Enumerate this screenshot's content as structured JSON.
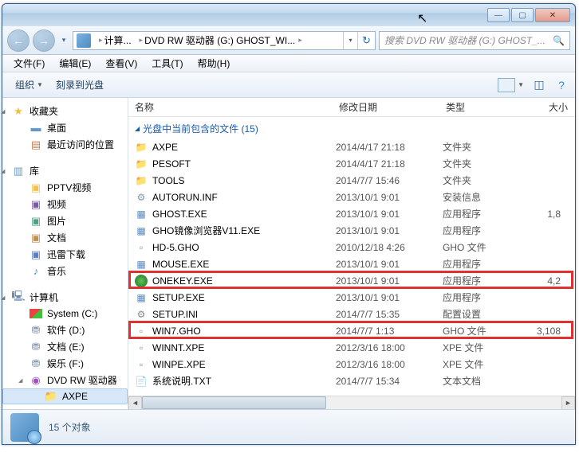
{
  "window": {
    "minimize_glyph": "—",
    "maximize_glyph": "▢",
    "close_glyph": "✕"
  },
  "nav": {
    "back_glyph": "←",
    "forward_glyph": "→",
    "history_glyph": "▾",
    "refresh_glyph": "↻",
    "dropdown_glyph": "▾",
    "segments": [
      "计算...",
      "DVD RW 驱动器 (G:) GHOST_WI..."
    ],
    "search_placeholder": "搜索 DVD RW 驱动器 (G:) GHOST_...",
    "search_glyph": "🔍"
  },
  "menu": {
    "file": "文件(F)",
    "edit": "编辑(E)",
    "view": "查看(V)",
    "tools": "工具(T)",
    "help": "帮助(H)"
  },
  "toolbar": {
    "organize": "组织",
    "burn": "刻录到光盘",
    "help_glyph": "?"
  },
  "tree": {
    "favorites": "收藏夹",
    "desktop": "桌面",
    "recent": "最近访问的位置",
    "libraries": "库",
    "pptv": "PPTV视频",
    "videos": "视频",
    "pictures": "图片",
    "documents": "文档",
    "downloads": "迅雷下载",
    "music": "音乐",
    "computer": "计算机",
    "system_c": "System (C:)",
    "soft_d": "软件 (D:)",
    "doc_e": "文档 (E:)",
    "ent_f": "娱乐 (F:)",
    "dvd_g": "DVD RW 驱动器",
    "axpe": "AXPE"
  },
  "columns": {
    "name": "名称",
    "date": "修改日期",
    "type": "类型",
    "size": "大小"
  },
  "group": {
    "triangle": "◢",
    "title": "光盘中当前包含的文件 (15)"
  },
  "rows": [
    {
      "icon": "folder",
      "name": "AXPE",
      "date": "2014/4/17 21:18",
      "type": "文件夹",
      "size": ""
    },
    {
      "icon": "folder",
      "name": "PESOFT",
      "date": "2014/4/17 21:18",
      "type": "文件夹",
      "size": ""
    },
    {
      "icon": "folder",
      "name": "TOOLS",
      "date": "2014/7/7 15:46",
      "type": "文件夹",
      "size": ""
    },
    {
      "icon": "inf",
      "name": "AUTORUN.INF",
      "date": "2013/10/1 9:01",
      "type": "安装信息",
      "size": ""
    },
    {
      "icon": "exe",
      "name": "GHOST.EXE",
      "date": "2013/10/1 9:01",
      "type": "应用程序",
      "size": "1,8"
    },
    {
      "icon": "exe",
      "name": "GHO镜像浏览器V11.EXE",
      "date": "2013/10/1 9:01",
      "type": "应用程序",
      "size": ""
    },
    {
      "icon": "gho",
      "name": "HD-5.GHO",
      "date": "2010/12/18 4:26",
      "type": "GHO 文件",
      "size": ""
    },
    {
      "icon": "exe",
      "name": "MOUSE.EXE",
      "date": "2013/10/1 9:01",
      "type": "应用程序",
      "size": ""
    },
    {
      "icon": "onekey",
      "name": "ONEKEY.EXE",
      "date": "2013/10/1 9:01",
      "type": "应用程序",
      "size": "4,2"
    },
    {
      "icon": "exe",
      "name": "SETUP.EXE",
      "date": "2013/10/1 9:01",
      "type": "应用程序",
      "size": ""
    },
    {
      "icon": "ini",
      "name": "SETUP.INI",
      "date": "2014/7/7 15:35",
      "type": "配置设置",
      "size": ""
    },
    {
      "icon": "gho",
      "name": "WIN7.GHO",
      "date": "2014/7/7 1:13",
      "type": "GHO 文件",
      "size": "3,108"
    },
    {
      "icon": "xpe",
      "name": "WINNT.XPE",
      "date": "2012/3/16 18:00",
      "type": "XPE 文件",
      "size": ""
    },
    {
      "icon": "xpe",
      "name": "WINPE.XPE",
      "date": "2012/3/16 18:00",
      "type": "XPE 文件",
      "size": ""
    },
    {
      "icon": "txt",
      "name": "系统说明.TXT",
      "date": "2014/7/7 15:34",
      "type": "文本文档",
      "size": ""
    }
  ],
  "status": {
    "count": "15 个对象"
  },
  "highlights": [
    {
      "row": 8
    },
    {
      "row": 11
    }
  ]
}
